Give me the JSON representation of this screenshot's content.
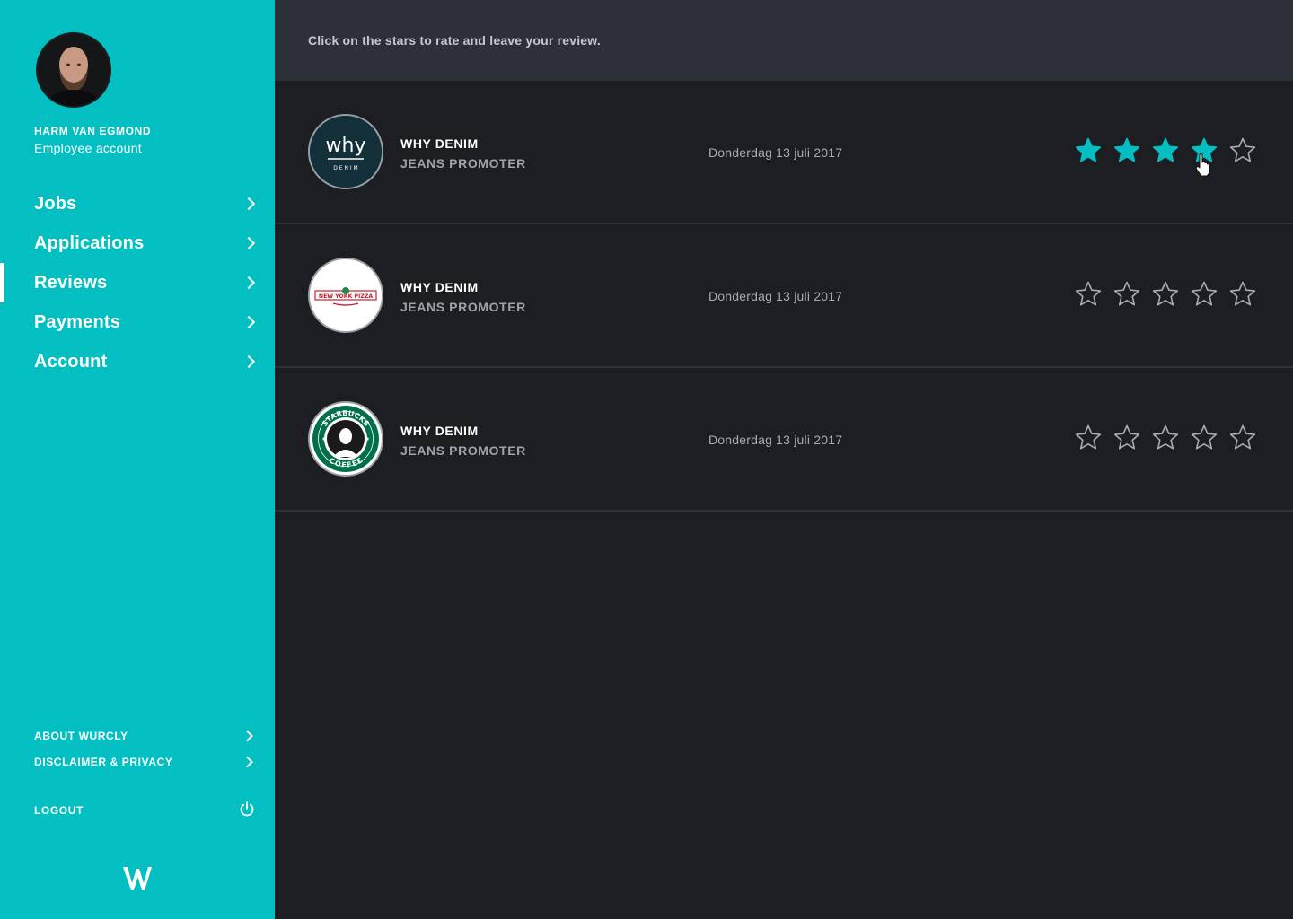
{
  "user": {
    "name": "HARM VAN EGMOND",
    "account_type": "Employee account"
  },
  "nav": {
    "items": [
      {
        "label": "Jobs",
        "active": false
      },
      {
        "label": "Applications",
        "active": false
      },
      {
        "label": "Reviews",
        "active": true
      },
      {
        "label": "Payments",
        "active": false
      },
      {
        "label": "Account",
        "active": false
      }
    ]
  },
  "footer_links": {
    "about": "ABOUT WURCLY",
    "disclaimer": "DISCLAIMER & PRIVACY",
    "logout": "LOGOUT"
  },
  "main": {
    "instruction": "Click on the stars to rate and leave your review."
  },
  "reviews": [
    {
      "company": "WHY DENIM",
      "role": "JEANS PROMOTER",
      "date": "Donderdag 13 juli 2017",
      "logo": "why-denim-logo",
      "logo_text": "why",
      "logo_subtext": "D E N I M",
      "rating": 4,
      "max_rating": 5
    },
    {
      "company": "WHY DENIM",
      "role": "JEANS PROMOTER",
      "date": "Donderdag 13 juli 2017",
      "logo": "new-york-pizza-logo",
      "logo_text": "NEW YORK PIZZA",
      "rating": 0,
      "max_rating": 5
    },
    {
      "company": "WHY DENIM",
      "role": "JEANS PROMOTER",
      "date": "Donderdag 13 juli 2017",
      "logo": "starbucks-coffee-logo",
      "logo_text": "STARBUCKS COFFEE",
      "rating": 0,
      "max_rating": 5
    }
  ],
  "colors": {
    "accent": "#03bfc1",
    "background": "#1d1e21",
    "topbar": "#2c3038",
    "star_empty": "#a7acb3"
  }
}
